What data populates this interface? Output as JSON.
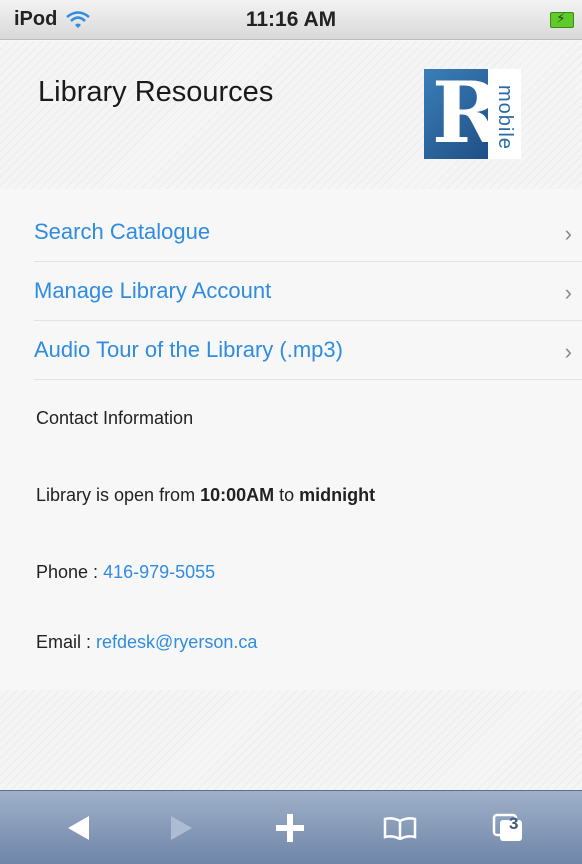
{
  "status_bar": {
    "carrier": "iPod",
    "time": "11:16 AM"
  },
  "header": {
    "title": "Library Resources",
    "logo_letter": "R",
    "logo_text": "mobile"
  },
  "menu": {
    "items": [
      {
        "label": "Search Catalogue"
      },
      {
        "label": "Manage Library Account"
      },
      {
        "label": "Audio Tour of the Library (.mp3)"
      }
    ]
  },
  "contact": {
    "heading": "Contact Information",
    "hours_prefix": "Library is open from ",
    "hours_open": "10:00AM",
    "hours_mid": " to ",
    "hours_close": "midnight",
    "phone_label": "Phone : ",
    "phone_value": "416-979-5055",
    "email_label": "Email : ",
    "email_value": "refdesk@ryerson.ca"
  },
  "toolbar": {
    "tabs_count": "3"
  },
  "colors": {
    "link": "#2f8ce0",
    "toolbar": "#7f95b5",
    "logo_blue": "#2a6aa4"
  }
}
